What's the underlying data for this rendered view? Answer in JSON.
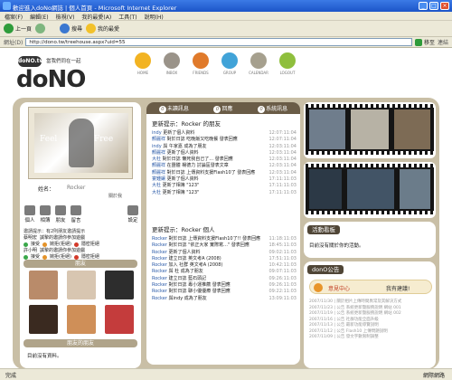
{
  "window": {
    "title": "歡迎進入doNo網誌 | 個人首頁 - Microsoft Internet Explorer"
  },
  "menu": [
    "檔案(F)",
    "編輯(E)",
    "檢視(V)",
    "我的最愛(A)",
    "工具(T)",
    "說明(H)"
  ],
  "toolbar": {
    "back": "上一頁",
    "search": "搜尋",
    "favorites": "我的最愛"
  },
  "address": {
    "label": "網址(D)",
    "url": "http://dono.tw/treehouse.aspx?uid=55",
    "go": "移至",
    "links": "連結"
  },
  "site": {
    "logo_small": "doNO.tw",
    "slogan": "當我們同在一起",
    "logo_big": "doNO",
    "nav": [
      {
        "label": "HOME",
        "color": "#f2b322"
      },
      {
        "label": "INBOX",
        "color": "#9a9389"
      },
      {
        "label": "FRIENDS",
        "color": "#e07a2b"
      },
      {
        "label": "GROUP",
        "color": "#41a3d8"
      },
      {
        "label": "CALENDAR",
        "color": "#a6a08e"
      },
      {
        "label": "LOGOUT",
        "color": "#8fbf3d"
      }
    ]
  },
  "profile": {
    "photo_text_left": "Feel",
    "photo_text_right": "Free",
    "name_label": "姓名：",
    "name_value": "Rocker",
    "id_label": "關於我",
    "actions": [
      "個人",
      "相簿",
      "朋友",
      "留言"
    ],
    "settings": "設定"
  },
  "invites": {
    "head": "邀請提示：有2則朋友邀請提示",
    "rows": [
      {
        "a": "蔡明宏",
        "b": "誠摯的邀請你參加遊戲"
      },
      {
        "a": "接受",
        "b": "婉拒(拒絕)",
        "c": "隱密拒絕"
      },
      {
        "a": "許小明",
        "b": "誠摯的邀請你參加遊戲"
      },
      {
        "a": "接受",
        "b": "婉拒(拒絕)",
        "c": "隱密拒絕"
      }
    ]
  },
  "friends_bar": "朋友",
  "friends_tiles": [
    "#b98b6a",
    "#d8c6b1",
    "#2d2d2d",
    "#3a2a20",
    "#cf8f58",
    "#c43c3c"
  ],
  "friend_news_bar": "朋友的朋友",
  "friend_news_empty": "目前沒有資料。",
  "tabs": [
    {
      "n": "0",
      "label": "未讀訊息"
    },
    {
      "n": "0",
      "label": "回應"
    },
    {
      "n": "0",
      "label": "系統訊息"
    }
  ],
  "update_friends": {
    "title": "更新提示：Rocker 的朋友",
    "rows": [
      {
        "who": "indy",
        "what": "更新了個人資料",
        "t": "12:07:11:04"
      },
      {
        "who": "顏麗祥",
        "what": "對於日誌 吃晚飯又吃晚餐 發表回應",
        "t": "12:07:11:04"
      },
      {
        "who": "indy",
        "what": "與 午家嘉 成為了朋友",
        "t": "12:03:11:04"
      },
      {
        "who": "顏麗祥",
        "what": "更新了個人資料",
        "t": "12:03:11:04"
      },
      {
        "who": "大杜",
        "what": "對於日誌 懶死我自己了… 發表回應",
        "t": "12:03:11:04"
      },
      {
        "who": "顏麗祥",
        "what": "在團體 楊德力 討論區發表文章",
        "t": "12:03:11:04"
      },
      {
        "who": "顏麗祥",
        "what": "對於日誌 上傳資料支援Flash10了 發表回應",
        "t": "12:03:11:04"
      },
      {
        "who": "宴鍾鑲",
        "what": "更新了個人資料",
        "t": "17:11:11:03"
      },
      {
        "who": "大杜",
        "what": "更新了相簿 \"123\"",
        "t": "17:11:11:03"
      },
      {
        "who": "大杜",
        "what": "更新了相簿 \"123\"",
        "t": "17:11:11:03"
      }
    ]
  },
  "update_me": {
    "title": "更新提示：Rocker 個人",
    "rows": [
      {
        "who": "Rocker",
        "what": "對於日誌 上傳資料支援Flash10了!! 發表回應",
        "t": "11:18:11:03"
      },
      {
        "who": "Rocker",
        "what": "對於日誌 \"依正大家 實際寫…\" 發表回應",
        "t": "18:45:11:03"
      },
      {
        "who": "Rocker",
        "what": "更新了個人資料",
        "t": "09:02:11:03"
      },
      {
        "who": "Rocker",
        "what": "建立日誌 英文考A (2008)",
        "t": "17:51:11:03"
      },
      {
        "who": "Rocker",
        "what": "加入 社群 英文考A (2008)",
        "t": "10:42:11:03"
      },
      {
        "who": "Rocker",
        "what": "與 杜 成為了朋友",
        "t": "09:07:11:03"
      },
      {
        "who": "Rocker",
        "what": "建立日誌 藍石頭記",
        "t": "09:26:11:03"
      },
      {
        "who": "Rocker",
        "what": "對於日誌 專小運推薦 發表回應",
        "t": "09:26:11:03"
      },
      {
        "who": "Rocker",
        "what": "對於日誌 聊小優優療 發表回應",
        "t": "09:22:11:03"
      },
      {
        "who": "Rocker",
        "what": "與indy 成為了朋友",
        "t": "13:09:11:03"
      }
    ]
  },
  "right": {
    "events_title": "活動看板",
    "events_empty": "目前沒有關於你的活動。",
    "notice_title": "donO公告",
    "notice_a": "意見中心",
    "notice_b": "我有建議!",
    "notice_lines": [
      "2007/11/30 | 關於相片上傳時間異常及其解決方式",
      "2007/11/23 | 公告 系統更新暨服務說明 網站 001",
      "2007/11/19 | 公告 系統更新暨服務說明 網站 002",
      "2007/11/16 | 公告 社群功能全面升級",
      "2007/11/13 | 公告 最新功能導覽說明",
      "2007/11/12 | 公告 Flash10 上傳問題說明",
      "2007/11/09 | 公告 發文字數限制調整"
    ]
  },
  "statusbar": {
    "left": "完成",
    "zone": "網際網路"
  }
}
